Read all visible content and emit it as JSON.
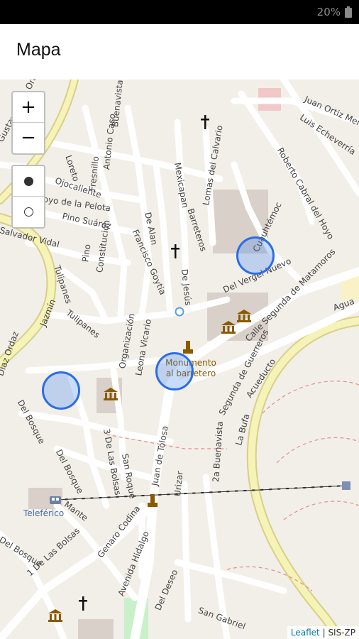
{
  "status_bar": {
    "battery_text": "20%"
  },
  "app_bar": {
    "title": "Mapa"
  },
  "map": {
    "controls": {
      "zoom_in": "+",
      "zoom_out": "−",
      "layer_options": [
        "filled-circle",
        "empty-circle"
      ]
    },
    "street_labels": [
      "Gustavo Díaz Ordaz",
      "Loreto",
      "Fresnillo",
      "Buenavista de",
      "Antonio Caso",
      "Ojocaliente",
      "Hoyo de la Pelota",
      "Pino Suárez",
      "Salvador Vidal",
      "Tulipanes",
      "Pino",
      "Constitución",
      "De Alan",
      "Francisco Goytia",
      "Mexicapan",
      "Barreteros",
      "Lomas del Calvario",
      "De Jesús",
      "Del Vergel Nuevo",
      "Cuauhtémoc",
      "Juan Ortiz Mena",
      "Luis Echeverría",
      "Roberto Cabral del Hoyo",
      "Calle Segunda de Matamoros",
      "Agua",
      "Jazmín",
      "Tulipanes",
      "Díaz Ordaz",
      "Organización",
      "Leona Vicario",
      "Segunda de Guerreros",
      "Acueducto",
      "La Bufa",
      "Del Bosque",
      "3 De Las Bolsas",
      "San Roque",
      "Del Bosque",
      "Juan de Tolosa",
      "Urizar",
      "2a Buenavista",
      "Mante",
      "Genaro Codina",
      "Avenida Hidalgo",
      "1 De Las Bolsas",
      "Del Bosque",
      "Del Deseo",
      "San Gabriel"
    ],
    "poi_labels": {
      "monument": "Monumento al barretero",
      "cable_car": "Teleférico"
    },
    "markers": [
      "circle-1",
      "circle-2",
      "circle-3"
    ],
    "attribution": {
      "link": "Leaflet",
      "separator": " | ",
      "source": "SIS-ZP"
    }
  },
  "colors": {
    "marker_stroke": "#2b6de8",
    "marker_fill": "#3b82f6",
    "major_road": "#f6f3b8",
    "highway_border": "#cfc67a",
    "map_background": "#f2efe9",
    "attribution_link": "#0078a8"
  }
}
